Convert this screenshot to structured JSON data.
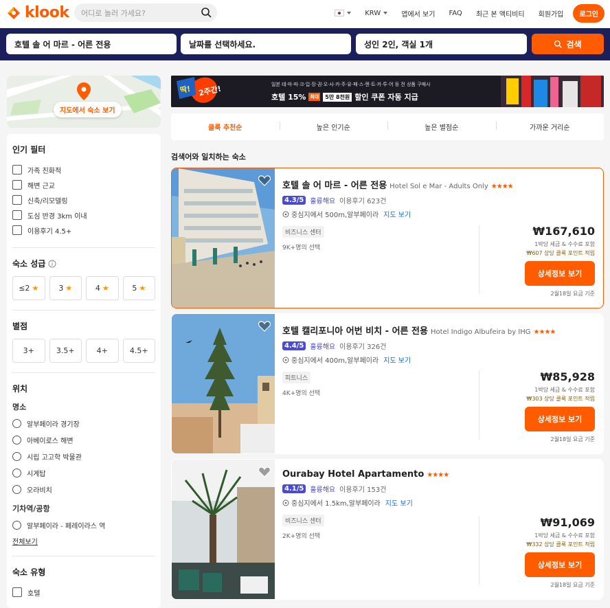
{
  "header": {
    "logo": "klook",
    "search_placeholder": "어디로 놀러 가세요?",
    "currency": "KRW",
    "nav": [
      "앱에서 보기",
      "FAQ",
      "최근 본 액티비티",
      "회원가입"
    ],
    "login": "로그인"
  },
  "search": {
    "destination": "호텔 솔 어 마르 - 어른 전용",
    "date": "날짜를 선택하세요.",
    "guests": "성인 2인, 객실 1개",
    "button": "검색"
  },
  "sidebar": {
    "map_button": "지도에서 숙소 보기",
    "popular_title": "인기 필터",
    "popular": [
      "가족 친화적",
      "해변 근교",
      "신축/리모델링",
      "도심 반경 3km 이내",
      "이용후기 4.5+"
    ],
    "grade_title": "숙소 성급",
    "grades": [
      "≤2",
      "3",
      "4",
      "5"
    ],
    "rating_title": "별점",
    "ratings": [
      "3+",
      "3.5+",
      "4+",
      "4.5+"
    ],
    "location_title": "위치",
    "landmark_title": "명소",
    "landmarks": [
      "알부페이라 경기장",
      "아베이로스 해변",
      "시립 고고학 박물관",
      "시계탑",
      "오라비치"
    ],
    "station_title": "기차역/공항",
    "stations": [
      "알부페이라 - 페레이라스 역"
    ],
    "see_all": "전체보기",
    "type_title": "숙소 유형",
    "types": [
      "호텔"
    ]
  },
  "banner": {
    "badge1": "딱!",
    "badge2": "2주간!",
    "top": "일본 테·마·파·크·입·장·권·오·사·카·주·유·패·스·렌·트·카·투·어 등 전 상품 구매시",
    "main": "호텔 15%",
    "max": "최대",
    "amount": "5만 8천원",
    "tail": "할인 쿠폰 자동 지급"
  },
  "sort": {
    "options": [
      "클룩 추천순",
      "높은 인기순",
      "높은 별점순",
      "가까운 거리순"
    ]
  },
  "results_title": "검색어와 일치하는 숙소",
  "hotels": [
    {
      "name": "호텔 솔 어 마르 - 어른 전용",
      "en": "Hotel Sol e Mar - Adults Only",
      "stars": "★★★★",
      "score": "4.3/5",
      "word": "훌륭해요",
      "reviews": "이용후기 623건",
      "loc": "중심지에서 500m,알부페이라",
      "map": "지도 보기",
      "tag": "비즈니스 센터",
      "sel": "9K+명의 선택",
      "price": "₩167,610",
      "tax": "1박당 세금 & 수수료 포함",
      "point": "₩607 상당 클룩 포인트 적립",
      "btn": "상세정보 보기",
      "date": "2월18일 요금 기준"
    },
    {
      "name": "호텔 캘리포니아 어번 비치 - 어른 전용",
      "en": "Hotel Indigo Albufeira by IHG",
      "stars": "★★★★",
      "score": "4.4/5",
      "word": "훌륭해요",
      "reviews": "이용후기 326건",
      "loc": "중심지에서 400m,알부페이라",
      "map": "지도 보기",
      "tag": "피트니스",
      "sel": "4K+명의 선택",
      "price": "₩85,928",
      "tax": "1박당 세금 & 수수료 포함",
      "point": "₩303 상당 클룩 포인트 적립",
      "btn": "상세정보 보기",
      "date": "2월18일 요금 기준"
    },
    {
      "name": "Ourabay Hotel Apartamento",
      "en": "",
      "stars": "★★★★",
      "score": "4.1/5",
      "word": "훌륭해요",
      "reviews": "이용후기 153건",
      "loc": "중심지에서 1.5km,알부페이라",
      "map": "지도 보기",
      "tag": "비즈니스 센터",
      "sel": "2K+명의 선택",
      "price": "₩91,069",
      "tax": "1박당 세금 & 수수료 포함",
      "point": "₩332 상당 클룩 포인트 적립",
      "btn": "상세정보 보기",
      "date": "2월18일 요금 기준"
    }
  ]
}
